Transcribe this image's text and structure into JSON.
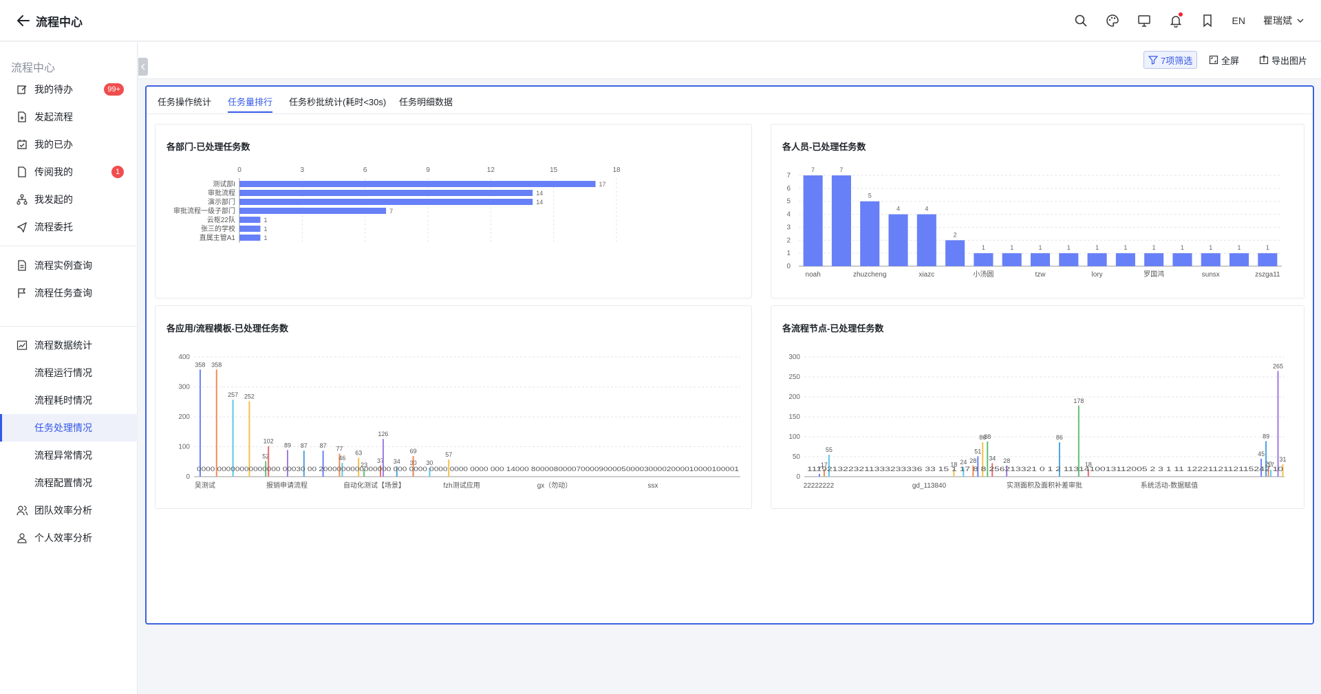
{
  "header": {
    "title": "流程中心",
    "lang": "EN",
    "user": "瞿瑞斌"
  },
  "sidebar": {
    "title": "流程中心",
    "items": [
      {
        "label": "我的待办",
        "badge": "99+"
      },
      {
        "label": "发起流程"
      },
      {
        "label": "我的已办"
      },
      {
        "label": "传阅我的",
        "badge": "1"
      },
      {
        "label": "我发起的"
      },
      {
        "label": "流程委托"
      },
      {
        "label": "流程实例查询"
      },
      {
        "label": "流程任务查询"
      },
      {
        "label": "流程数据统计"
      },
      {
        "label": "流程运行情况"
      },
      {
        "label": "流程耗时情况"
      },
      {
        "label": "任务处理情况"
      },
      {
        "label": "流程异常情况"
      },
      {
        "label": "流程配置情况"
      },
      {
        "label": "团队效率分析"
      },
      {
        "label": "个人效率分析"
      }
    ]
  },
  "toolbar": {
    "filter": "7项筛选",
    "fullscreen": "全屏",
    "export": "导出图片"
  },
  "tabs": [
    "任务操作统计",
    "任务量排行",
    "任务秒批统计(耗时<30s)",
    "任务明细数据"
  ],
  "colors": {
    "accent": "#3558e8",
    "bar": "#6780f7",
    "badge": "#f04e4e"
  },
  "chart_data": [
    {
      "type": "bar",
      "orientation": "horizontal",
      "title": "各部门-已处理任务数",
      "categories": [
        "测试部I",
        "审批流程",
        "演示部门",
        "审批流程一级子部门",
        "云枢22队",
        "张三的学校",
        "直属主管A1"
      ],
      "values": [
        17,
        14,
        14,
        7,
        1,
        1,
        1
      ],
      "xlim": [
        0,
        18
      ],
      "xticks": [
        "0",
        "3",
        "6",
        "9",
        "12",
        "15",
        "18"
      ]
    },
    {
      "type": "bar",
      "title": "各人员-已处理任务数",
      "categories": [
        "noah",
        "",
        "zhuzcheng",
        "",
        "xiazc",
        "",
        "小汤圆",
        "",
        "tzw",
        "",
        "lory",
        "",
        "罗国鸿",
        "",
        "sunsx",
        "",
        "zszga11"
      ],
      "values": [
        7,
        7,
        5,
        4,
        4,
        2,
        1,
        1,
        1,
        1,
        1,
        1,
        1,
        1,
        1,
        1,
        1
      ],
      "ylim": [
        0,
        7
      ],
      "yticks": [
        "0",
        "1",
        "2",
        "3",
        "4",
        "5",
        "6",
        "7"
      ]
    },
    {
      "type": "bar",
      "title": "各应用/流程模板-已处理任务数",
      "ylim": [
        0,
        400
      ],
      "yticks": [
        "0",
        "100",
        "200",
        "300",
        "400"
      ],
      "xlabels": [
        "吴测试",
        "报销申请流程",
        "自动化测试【场景】",
        "fzh测试应用",
        "gx（勿动）",
        "ssx"
      ],
      "labelled_values": [
        358,
        358,
        257,
        252,
        52,
        102,
        89,
        87,
        87,
        77,
        46,
        63,
        23,
        37,
        126,
        34,
        30,
        69,
        30,
        57
      ],
      "baseline_labels": "0000 00000000000000 00030 00 2000000000000000 000 0000 0000 0000 0000 000 14000 8000080000700009000050000300002000010000100001"
    },
    {
      "type": "bar",
      "title": "各流程节点-已处理任务数",
      "ylim": [
        0,
        300
      ],
      "yticks": [
        "0",
        "50",
        "100",
        "150",
        "200",
        "250",
        "300"
      ],
      "xlabels": [
        "22222222",
        "gd_113840",
        "实测面积及面积补差审批",
        "系统活动-数据赋值"
      ],
      "labelled_values": [
        7,
        17,
        55,
        86,
        88,
        34,
        28,
        86,
        51,
        28,
        24,
        18,
        178,
        18,
        265,
        89,
        45,
        20,
        17,
        31
      ],
      "baseline_labels": "1119213223211333233336 33 15 1 17 8 8 256213321 0 1 2 1131410013112005 2 3 1 11 1222112112115242 10"
    }
  ]
}
